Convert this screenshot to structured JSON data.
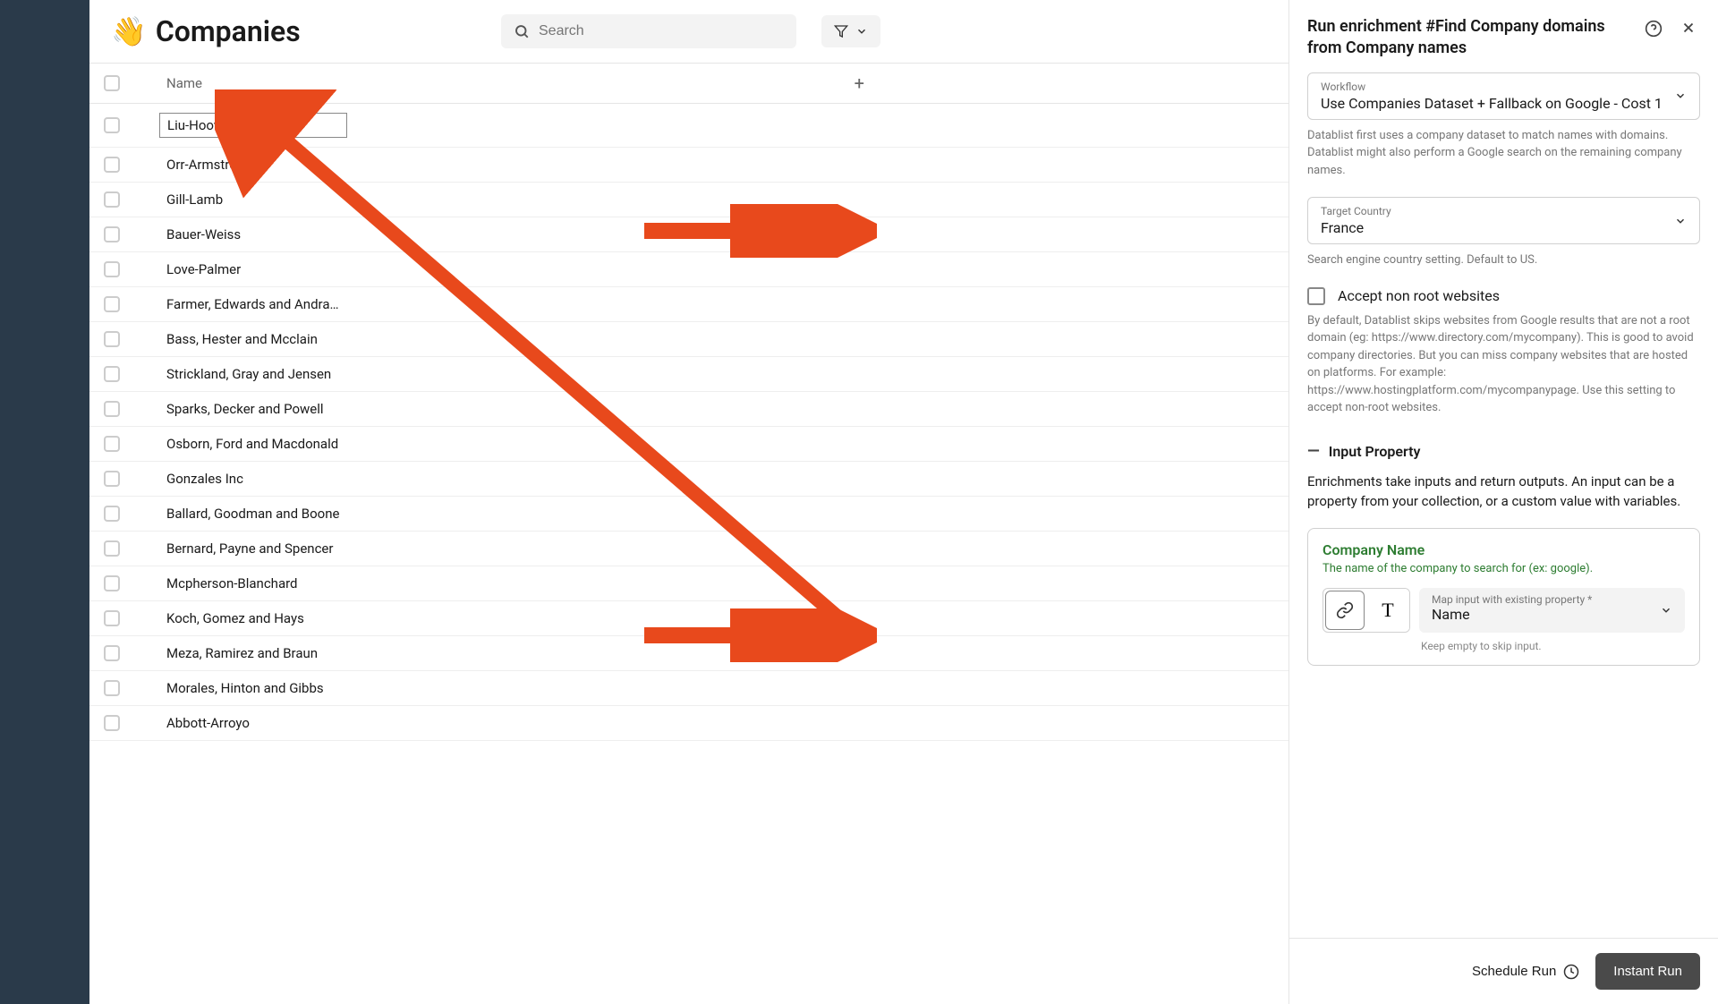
{
  "header": {
    "emoji": "👋",
    "title": "Companies",
    "search_placeholder": "Search"
  },
  "table": {
    "column": "Name",
    "rows": [
      "Liu-Hoover",
      "Orr-Armstrong",
      "Gill-Lamb",
      "Bauer-Weiss",
      "Love-Palmer",
      "Farmer, Edwards and Andra…",
      "Bass, Hester and Mcclain",
      "Strickland, Gray and Jensen",
      "Sparks, Decker and Powell",
      "Osborn, Ford and Macdonald",
      "Gonzales Inc",
      "Ballard, Goodman and Boone",
      "Bernard, Payne and Spencer",
      "Mcpherson-Blanchard",
      "Koch, Gomez and Hays",
      "Meza, Ramirez and Braun",
      "Morales, Hinton and Gibbs",
      "Abbott-Arroyo"
    ]
  },
  "panel": {
    "title": "Run enrichment #Find Company domains from Company names",
    "workflow": {
      "label": "Workflow",
      "value": "Use Companies Dataset + Fallback on Google - Cost 1",
      "help": "Datablist first uses a company dataset to match names with domains. Datablist might also perform a Google search on the remaining company names."
    },
    "country": {
      "label": "Target Country",
      "value": "France",
      "help": "Search engine country setting. Default to US."
    },
    "nonroot": {
      "label": "Accept non root websites",
      "help": "By default, Datablist skips websites from Google results that are not a root domain (eg: https://www.directory.com/mycompany). This is good to avoid company directories. But you can miss company websites that are hosted on platforms. For example: https://www.hostingplatform.com/mycompanypage. Use this setting to accept non-root websites."
    },
    "input_section": {
      "title": "Input Property",
      "desc": "Enrichments take inputs and return outputs. An input can be a property from your collection, or a custom value with variables."
    },
    "company_input": {
      "title": "Company Name",
      "sub": "The name of the company to search for (ex: google).",
      "map_label": "Map input with existing property *",
      "map_value": "Name",
      "map_hint": "Keep empty to skip input."
    },
    "footer": {
      "schedule": "Schedule Run",
      "run": "Instant Run"
    }
  }
}
